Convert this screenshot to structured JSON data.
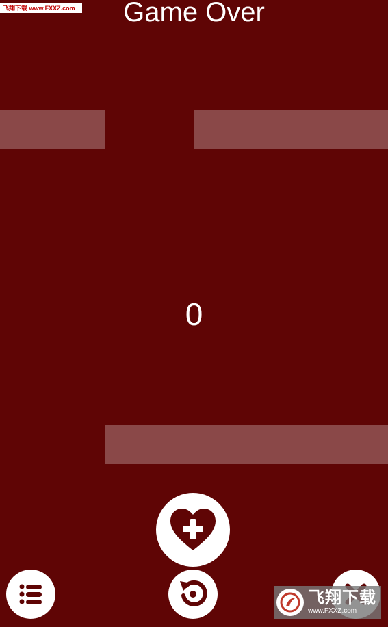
{
  "watermark_top": "飞翔下载 www.FXXZ.com",
  "title": "Game Over",
  "score": "0",
  "watermark_bottom": {
    "text": "飞翔下载",
    "url": "www.FXXZ.com"
  },
  "colors": {
    "background": "#5f0505",
    "bar": "rgba(255,255,255,0.27)",
    "button": "#ffffff",
    "icon": "#5f0505"
  },
  "buttons": {
    "extra_life": "heart-plus-icon",
    "menu": "list-icon",
    "restart": "restart-icon",
    "close": "close-icon"
  }
}
